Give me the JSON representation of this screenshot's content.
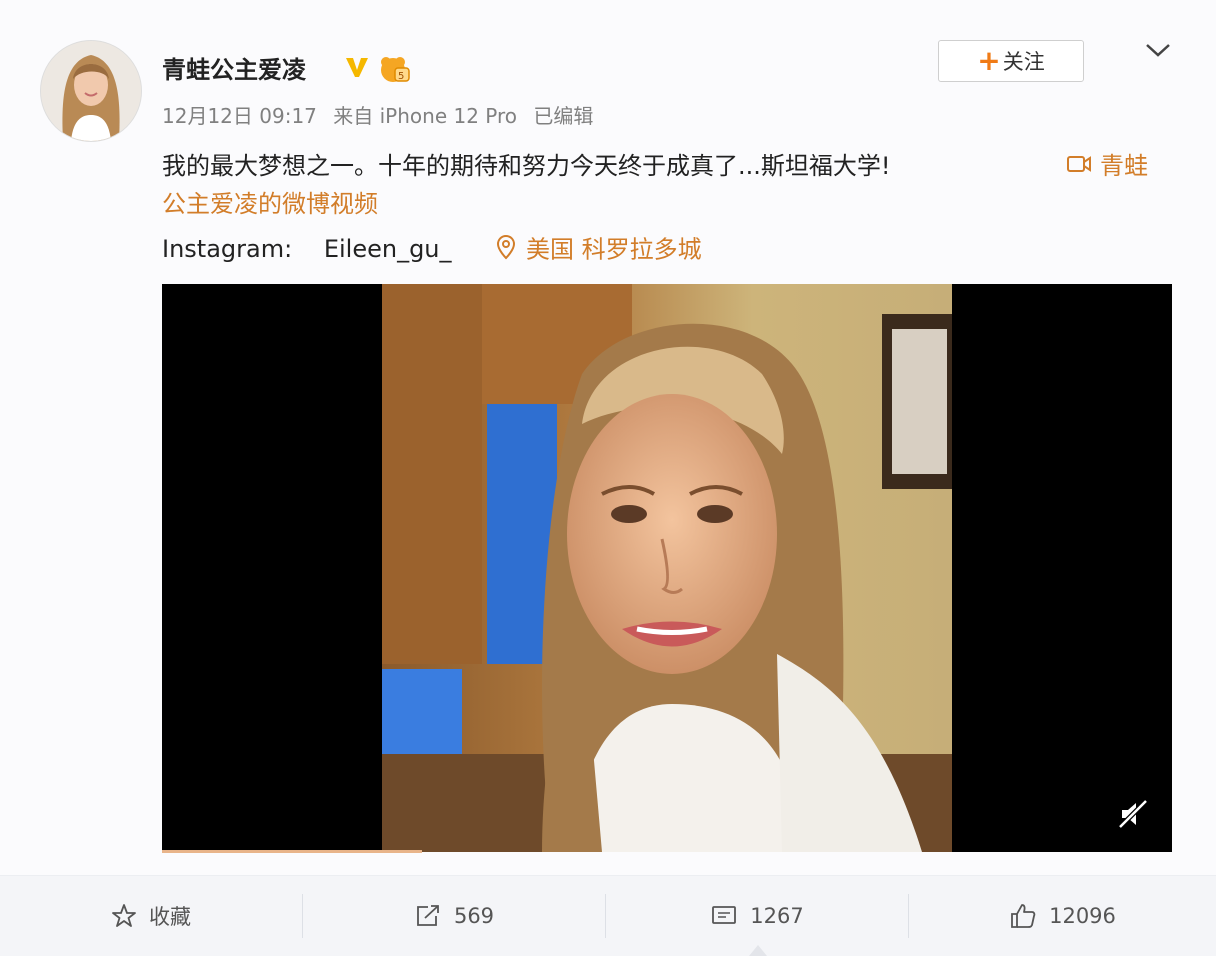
{
  "post": {
    "username": "青蛙公主爱凌",
    "timestamp": "12月12日 09:17",
    "source": "来自 iPhone 12 Pro",
    "edited": "已编辑",
    "follow_label": "关注",
    "text_main": "我的最大梦想之一。十年的期待和努力今天终于成真了...斯坦福大学!",
    "video_link_1": "青蛙",
    "video_link_2": "公主爱凌的微博视频",
    "instagram_label": "Instagram:",
    "instagram_handle": "Eileen_gu_",
    "location": "美国 科罗拉多城"
  },
  "actions": {
    "favorite": "收藏",
    "repost": "569",
    "comment": "1267",
    "like": "12096"
  },
  "icons": {
    "verified": "verified-v-icon",
    "level": "level-badge-icon",
    "menu": "chevron-down-icon",
    "video": "video-link-icon",
    "location": "location-pin-icon",
    "mute": "muted-speaker-icon",
    "star": "star-icon",
    "repost": "repost-icon",
    "comment": "comment-icon",
    "like": "thumbs-up-icon"
  },
  "colors": {
    "accent": "#d27d29",
    "follow_plus": "#f07b16",
    "verified": "#f5b800"
  }
}
